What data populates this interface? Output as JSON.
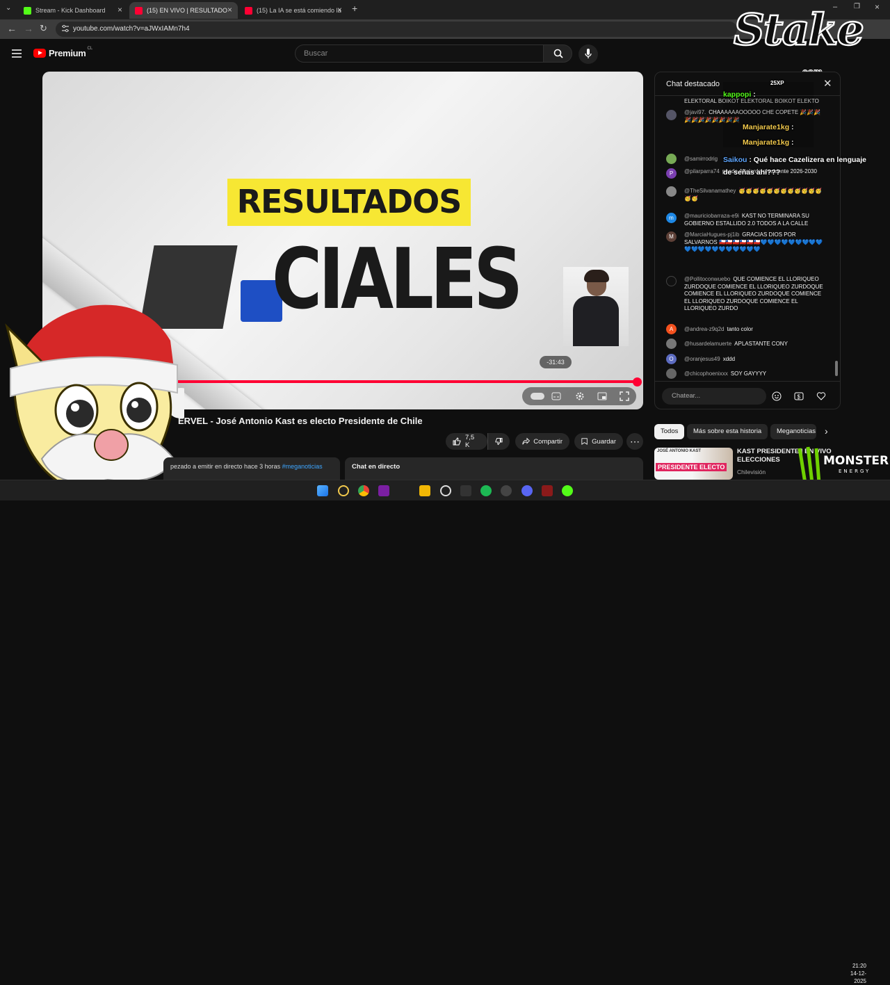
{
  "browser": {
    "tabs": [
      {
        "title": "Stream - Kick Dashboard",
        "favicon_color": "#53fc18"
      },
      {
        "title": "(15) EN VIVO | RESULTADO",
        "favicon_color": "#ff0033"
      },
      {
        "title": "(15) La IA se está comiendo la",
        "favicon_color": "#ff0033"
      }
    ],
    "new_tab_symbol": "+",
    "url": "youtube.com/watch?v=aJWxIAMn7h4"
  },
  "youtube": {
    "logo_text": "Premium",
    "region": "CL",
    "search_placeholder": "Buscar"
  },
  "video": {
    "headline": "RESULTADOS",
    "headline_partial": "CIALES",
    "time_remaining": "-31:43",
    "progress": 0.99,
    "title_partial": "ERVEL - José Antonio Kast es electo Presidente de Chile"
  },
  "actions": {
    "likes": "7,5 K",
    "share": "Compartir",
    "save": "Guardar"
  },
  "description": {
    "text": "pezado a emitir en directo hace 3 horas",
    "hashtag": "#meganoticias"
  },
  "chat_replay_label": "Chat en directo",
  "chat": {
    "header": "Chat destacado",
    "messages": [
      {
        "author": "",
        "text": "ELEKTORAL BOIKOT ELEKTORAL BOIKOT ELEKTO",
        "avatar_color": "#444"
      },
      {
        "author": "@javi97.",
        "text": "CHAAAAAAOOOOO CHE COPETE 🎉🎉🎉🎉🎉🎉🎉🎉🎉🎉🎉",
        "avatar_color": "#556"
      },
      {
        "author": "@samirrodrig",
        "text": "",
        "avatar_color": "#7a5"
      },
      {
        "author": "@pilarparra74",
        "text": "puede Abelardo presidente 2026-2030",
        "avatar_color": "#7b3fb0",
        "initial": "P"
      },
      {
        "author": "@TheSilvanamathey",
        "text": "🥳🥳🥳🥳🥳🥳🥳🥳🥳🥳🥳🥳🥳🥳",
        "avatar_color": "#888"
      },
      {
        "author": "@mauriciobarraza-e9i",
        "text": "KAST NO TERMINARA SU GOBIERNO ESTALLIDO 2.0 TODOS A LA CALLE",
        "avatar_color": "#1e88e5",
        "initial": "m"
      },
      {
        "author": "@MarciaHugues-pj1ib",
        "text": "GRACIAS DIOS POR SALVARNOS 🇨🇱🇨🇱🇨🇱🇨🇱🇨🇱🇨🇱💙💙💙💙💙💙💙💙💙💙💙💙💙💙💙💙💙💙💙💙",
        "avatar_color": "#5d4037",
        "initial": "M"
      },
      {
        "author": "@Pollitoconwuebo",
        "text": "QUE COMIENCE EL LLORIQUEO ZURDOQUE COMIENCE EL LLORIQUEO ZURDOQUE COMIENCE EL LLORIQUEO ZURDOQUE COMIENCE EL LLORIQUEO ZURDOQUE COMIENCE EL LLORIQUEO ZURDO",
        "avatar_color": "#111"
      },
      {
        "author": "@andrea-z9q2d",
        "text": "tanto color",
        "avatar_color": "#f4511e",
        "initial": "A"
      },
      {
        "author": "@husardelamuerte",
        "text": "APLASTANTE CONY",
        "avatar_color": "#777"
      },
      {
        "author": "@oranjesus49",
        "text": "xddd",
        "avatar_color": "#5c6bc0",
        "initial": "O"
      },
      {
        "author": "@chicophoenixxx",
        "text": "SOY GAYYYY",
        "avatar_color": "#666"
      }
    ],
    "input_placeholder": "Chatear..."
  },
  "overlay_chat": [
    {
      "name": "kappopi",
      "text": ":"
    },
    {
      "name": "Manjarate1kg",
      "text": ":"
    },
    {
      "name": "Manjarate1kg",
      "text": ":"
    },
    {
      "name": "Saikou",
      "text": ": Qué hace Cazelizera en lenguaje de señas ahí???"
    }
  ],
  "overlay_badge": "25XP",
  "stake": {
    "logo": "Stake",
    "domain": ".com"
  },
  "chips": [
    "Todos",
    "Más sobre esta historia",
    "Meganoticias"
  ],
  "recommended": {
    "thumb_name": "JOSÉ ANTONIO KAST",
    "thumb_badge": "PRESIDENTE ELECTO",
    "title": "KAST PRESIDENTE | EN VIVO ELECCIONES",
    "channel": "Chilevisión"
  },
  "monster_text": "MONSTER",
  "monster_sub": "ENERGY",
  "taskbar": {
    "time": "21:20",
    "date": "14-12-2025"
  }
}
